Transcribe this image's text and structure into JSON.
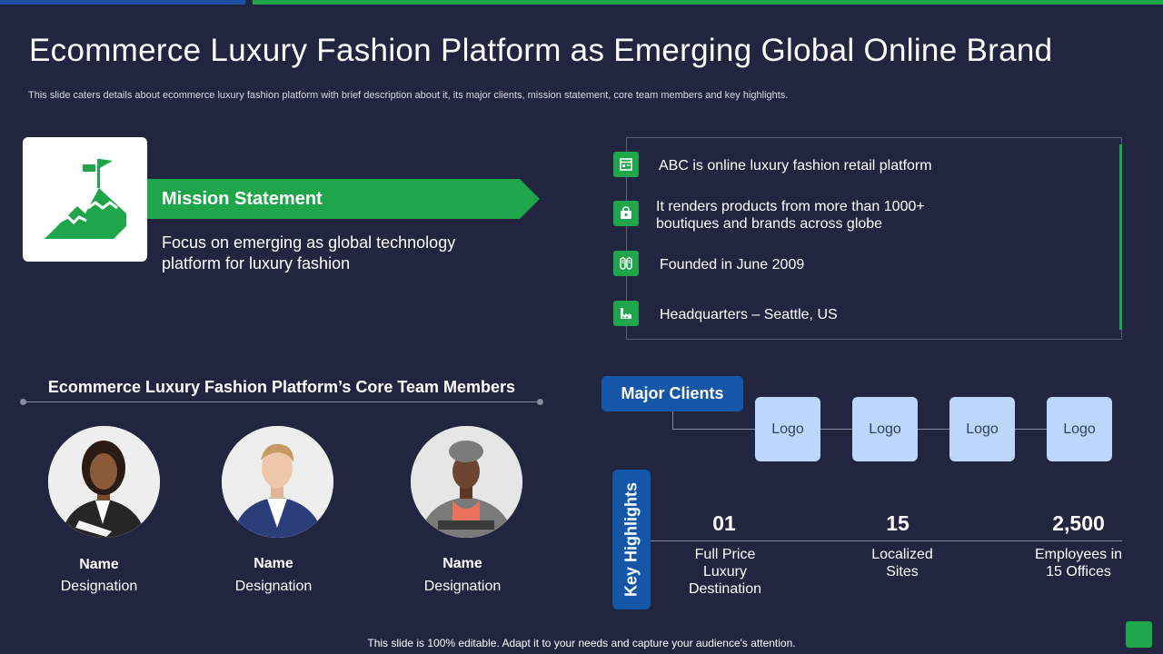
{
  "header": {
    "title": "Ecommerce Luxury Fashion Platform as Emerging Global Online Brand",
    "subtitle": "This slide caters details about ecommerce luxury fashion platform with brief description about it, its major clients, mission statement, core team members and key highlights."
  },
  "mission": {
    "heading": "Mission Statement",
    "body": "Focus on emerging as global technology platform for luxury  fashion",
    "icon": "mountain-flag-icon"
  },
  "facts": [
    {
      "text": "ABC is online luxury  fashion retail platform",
      "icon": "browser-icon"
    },
    {
      "text_line1": "It renders products from more than 1000+",
      "text_line2": "boutiques and brands across globe",
      "icon": "shopping-bag-icon"
    },
    {
      "text": "Founded in June 2009",
      "icon": "flip-flops-icon"
    },
    {
      "text": "Headquarters – Seattle, US",
      "icon": "factory-icon"
    }
  ],
  "team": {
    "title": "Ecommerce Luxury Fashion Platform’s Core Team Members",
    "members": [
      {
        "name": "Name",
        "designation": "Designation"
      },
      {
        "name": "Name",
        "designation": "Designation"
      },
      {
        "name": "Name",
        "designation": "Designation"
      }
    ]
  },
  "clients": {
    "label": "Major Clients",
    "logos": [
      "Logo",
      "Logo",
      "Logo",
      "Logo"
    ]
  },
  "highlights": {
    "label": "Key Highlights",
    "items": [
      {
        "value": "01",
        "desc_line1": "Full Price",
        "desc_line2": "Luxury",
        "desc_line3": "Destination"
      },
      {
        "value": "15",
        "desc_line1": "Localized",
        "desc_line2": "Sites"
      },
      {
        "value": "2,500",
        "desc_line1": "Employees in",
        "desc_line2": "15 Offices"
      }
    ]
  },
  "footer": {
    "text": "This slide is 100% editable. Adapt it to your needs and capture your audience's attention."
  },
  "colors": {
    "background": "#222540",
    "accent_green": "#1fa64a",
    "accent_blue": "#1456a8",
    "logo_box": "#bcd7fb"
  }
}
